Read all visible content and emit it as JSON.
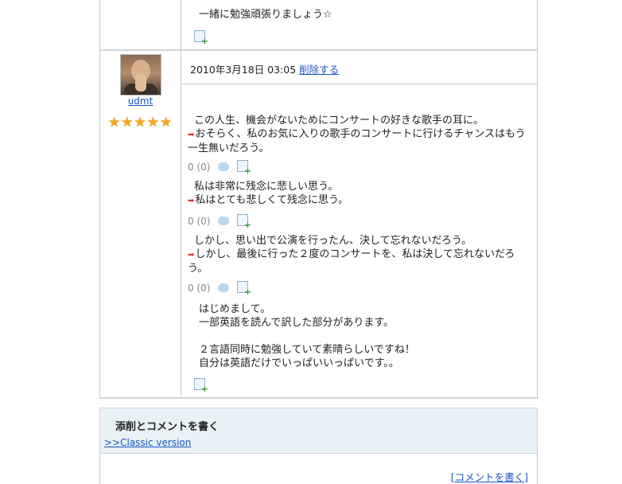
{
  "previous_entry": {
    "text": "一緒に勉強頑張りましょう☆"
  },
  "entry": {
    "username": "udmt",
    "stars": "★★★★★",
    "date": "2010年3月18日 03:05",
    "delete_label": "削除する",
    "corrections": [
      {
        "original": "この人生、機会がないためにコンサートの好きな歌手の耳に。",
        "corrected": "おそらく、私のお気に入りの歌手のコンサートに行けるチャンスはもう一生無いだろう。",
        "rating": "0  (0)"
      },
      {
        "original": "私は非常に残念に悲しい思う。",
        "corrected": "私はとても悲しくて残念に思う。",
        "rating": "0  (0)"
      },
      {
        "original": "しかし、思い出で公演を行ったん、決して忘れないだろう。",
        "corrected": "しかし、最後に行った２度のコンサートを、私は決して忘れないだろう。",
        "rating": "0  (0)"
      }
    ],
    "comment_lines": [
      "はじめまして。",
      "一部英語を読んで訳した部分があります。",
      "",
      "２言語同時に勉強していて素晴らしいですね！",
      "自分は英語だけでいっぱいいっぱいです。。"
    ]
  },
  "write_panel": {
    "title": "添削とコメントを書く",
    "classic_link": ">>Classic version",
    "write_link": "[コメントを書く]"
  },
  "icons": {
    "correction_arrow": "arrow-right-icon",
    "comment": "speech-bubble-icon",
    "favorite": "favorite-add-icon",
    "star": "star-icon"
  },
  "colors": {
    "link": "#1a55c8",
    "panel_bg": "#e8f1f6",
    "star": "#f5a623",
    "arrow": "#dd3333"
  }
}
